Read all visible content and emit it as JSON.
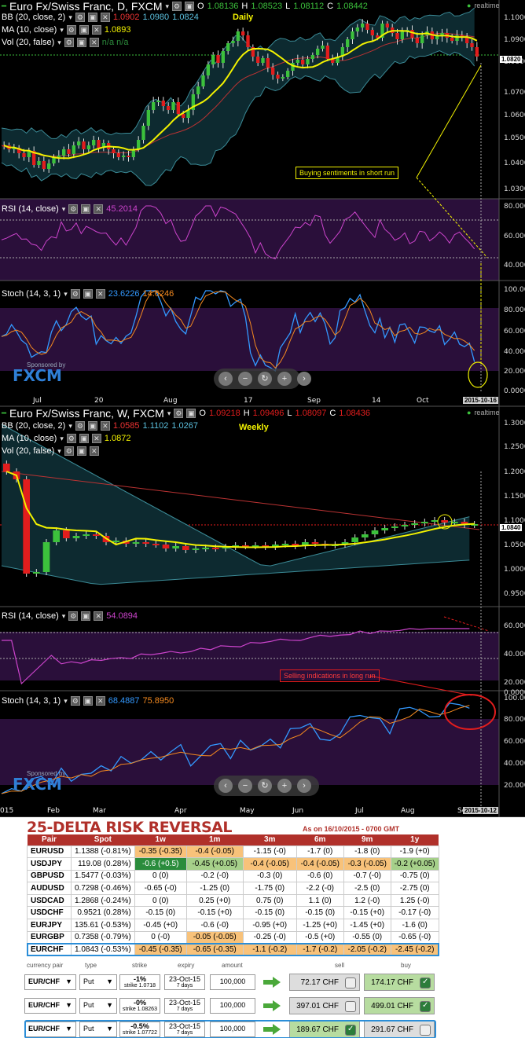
{
  "daily": {
    "title": "Euro Fx/Swiss Franc, D, FXCM",
    "ohlc": {
      "o_label": "O",
      "o": "1.08136",
      "h_label": "H",
      "h": "1.08523",
      "l_label": "L",
      "l": "1.08112",
      "c_label": "C",
      "c": "1.08442"
    },
    "realtime": "realtime",
    "bb_label": "BB (20, close, 2)",
    "bb_values": [
      "1.0902",
      "1.0980",
      "1.0824"
    ],
    "ma_label": "MA (10, close)",
    "ma_value": "1.0893",
    "vol_label": "Vol (20, false)",
    "vol_values": "n/a  n/a",
    "period_label": "Daily",
    "price_axis": [
      "1.10000",
      "1.09000",
      "1.08000",
      "1.07000",
      "1.06000",
      "1.05000",
      "1.04000",
      "1.03000"
    ],
    "price_tag": "1.0820",
    "annotation": "Buying sentiments in short run",
    "rsi_label": "RSI (14, close)",
    "rsi_value": "45.2014",
    "rsi_axis": [
      "80.0000",
      "60.0000",
      "40.0000"
    ],
    "stoch_label": "Stoch (14, 3, 1)",
    "stoch_k": "23.6226",
    "stoch_d": "14.6246",
    "stoch_axis": [
      "100.000",
      "80.0000",
      "60.0000",
      "40.0000",
      "20.0000",
      "0.0000"
    ],
    "x_labels": [
      "Jul",
      "20",
      "Aug",
      "17",
      "Sep",
      "14",
      "Oct"
    ],
    "date_tag": "2015-10-16",
    "sponsor": "Sponsored by",
    "brand": "FXCM"
  },
  "weekly": {
    "title": "Euro Fx/Swiss Franc, W, FXCM",
    "ohlc": {
      "o_label": "O",
      "o": "1.09218",
      "h_label": "H",
      "h": "1.09496",
      "l_label": "L",
      "l": "1.08097",
      "c_label": "C",
      "c": "1.08436"
    },
    "realtime": "realtime",
    "bb_label": "BB (20, close, 2)",
    "bb_values": [
      "1.0585",
      "1.1102",
      "1.0267"
    ],
    "ma_label": "MA (10, close)",
    "ma_value": "1.0872",
    "vol_label": "Vol (20, false)",
    "period_label": "Weekly",
    "price_axis": [
      "1.30000",
      "1.25000",
      "1.20000",
      "1.15000",
      "1.10000",
      "1.05000",
      "1.00000",
      "0.95000"
    ],
    "price_tag": "1.0840",
    "annotation": "Selling indications in long run",
    "rsi_label": "RSI (14, close)",
    "rsi_value": "54.0894",
    "rsi_axis": [
      "60.0000",
      "40.0000",
      "20.0000",
      "0.0000"
    ],
    "stoch_label": "Stoch (14, 3, 1)",
    "stoch_k": "68.4887",
    "stoch_d": "75.8950",
    "stoch_axis": [
      "100.000",
      "80.0000",
      "60.0000",
      "40.0000",
      "20.0000"
    ],
    "x_labels": [
      "015",
      "Feb",
      "Mar",
      "Apr",
      "May",
      "Jun",
      "Jul",
      "Aug",
      "Sep"
    ],
    "date_tag": "2015-10-12",
    "sponsor": "Sponsored by",
    "brand": "FXCM"
  },
  "colors": {
    "green": "#3cc13c",
    "red": "#e21d1d",
    "ma": "#f2f200",
    "rsi": "#cc44cc",
    "stoch_k": "#3399ff",
    "stoch_d": "#f58a1f"
  },
  "risk_reversal": {
    "title": "25-DELTA RISK REVERSAL",
    "as_of": "As on 16/10/2015 - 0700 GMT",
    "columns": [
      "Pair",
      "Spot",
      "1w",
      "1m",
      "3m",
      "6m",
      "9m",
      "1y"
    ],
    "rows": [
      [
        "EURUSD",
        "1.1388 (-0.81%)",
        "-0.35 (-0.35)",
        "-0.4 (-0.05)",
        "-1.15 (-0)",
        "-1.7 (0)",
        "-1.8 (0)",
        "-1.9 (+0)"
      ],
      [
        "USDJPY",
        "119.08 (0.28%)",
        "-0.6 (+0.5)",
        "-0.45 (+0.05)",
        "-0.4 (-0.05)",
        "-0.4 (-0.05)",
        "-0.3 (-0.05)",
        "-0.2 (+0.05)"
      ],
      [
        "GBPUSD",
        "1.5477 (-0.03%)",
        "0 (0)",
        "-0.2 (-0)",
        "-0.3 (0)",
        "-0.6 (0)",
        "-0.7 (-0)",
        "-0.75 (0)"
      ],
      [
        "AUDUSD",
        "0.7298 (-0.46%)",
        "-0.65 (-0)",
        "-1.25 (0)",
        "-1.75 (0)",
        "-2.2 (-0)",
        "-2.5 (0)",
        "-2.75 (0)"
      ],
      [
        "USDCAD",
        "1.2868 (-0.24%)",
        "0 (0)",
        "0.25 (+0)",
        "0.75 (0)",
        "1.1 (0)",
        "1.2 (-0)",
        "1.25 (-0)"
      ],
      [
        "USDCHF",
        "0.9521 (0.28%)",
        "-0.15 (0)",
        "-0.15 (+0)",
        "-0.15 (0)",
        "-0.15 (0)",
        "-0.15 (+0)",
        "-0.17 (-0)"
      ],
      [
        "EURJPY",
        "135.61 (-0.53%)",
        "-0.45 (+0)",
        "-0.6 (-0)",
        "-0.95 (+0)",
        "-1.25 (+0)",
        "-1.45 (+0)",
        "-1.6 (0)"
      ],
      [
        "EURGBP",
        "0.7358 (-0.79%)",
        "0 (-0)",
        "-0.05 (-0.05)",
        "-0.25 (-0)",
        "-0.5 (+0)",
        "-0.55 (0)",
        "-0.65 (-0)"
      ],
      [
        "EURCHF",
        "1.0843 (-0.53%)",
        "-0.45 (-0.35)",
        "-0.65 (-0.35)",
        "-1.1 (-0.2)",
        "-1.7 (-0.2)",
        "-2.05 (-0.2)",
        "-2.45 (-0.2)"
      ]
    ]
  },
  "options": {
    "headers": [
      "currency pair",
      "type",
      "strike",
      "expiry",
      "amount",
      "sell",
      "buy"
    ],
    "rows": [
      {
        "pair": "EUR/CHF",
        "type": "Put",
        "strike": "-1%",
        "strike_sub": "strike 1.0718",
        "expiry": "23-Oct-15",
        "expiry_sub": "7 days",
        "amount": "100,000",
        "sell": "72.17 CHF",
        "buy": "174.17 CHF"
      },
      {
        "pair": "EUR/CHF",
        "type": "Put",
        "strike": "-0%",
        "strike_sub": "strike 1.08263",
        "expiry": "23-Oct-15",
        "expiry_sub": "7 days",
        "amount": "100,000",
        "sell": "397.01 CHF",
        "buy": "499.01 CHF"
      },
      {
        "pair": "EUR/CHF",
        "type": "Put",
        "strike": "-0.5%",
        "strike_sub": "strike 1.07722",
        "expiry": "23-Oct-15",
        "expiry_sub": "7 days",
        "amount": "100,000",
        "sell": "189.67 CHF",
        "buy": "291.67 CHF"
      }
    ]
  }
}
